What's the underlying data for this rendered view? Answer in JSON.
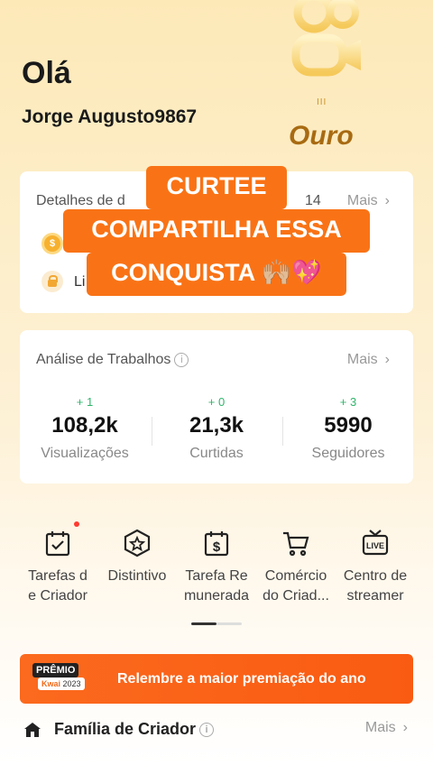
{
  "greeting": "Olá",
  "username": "Jorge Augusto9867",
  "level": {
    "tier": "Ouro",
    "roman": "III"
  },
  "earnings_card": {
    "title_start": "Detalhes de d",
    "title_suffix": "14",
    "more": "Mais",
    "row2_text_start": "Li"
  },
  "overlay": {
    "line1": "CURTEE",
    "line2": "COMPARTILHA ESSA",
    "line3": "CONQUISTA 🙌🏼💖"
  },
  "analytics": {
    "title": "Análise de Trabalhos",
    "more": "Mais",
    "stats": [
      {
        "delta": "+ 1",
        "value": "108,2k",
        "label": "Visualizações"
      },
      {
        "delta": "+ 0",
        "value": "21,3k",
        "label": "Curtidas"
      },
      {
        "delta": "+ 3",
        "value": "5990",
        "label": "Seguidores"
      }
    ]
  },
  "tools": [
    {
      "line1": "Tarefas d",
      "line2": "e Criador",
      "icon": "calendar-check-icon",
      "has_dot": true
    },
    {
      "line1": "Distintivo",
      "line2": "",
      "icon": "star-badge-icon",
      "has_dot": false
    },
    {
      "line1": "Tarefa Re",
      "line2": "munerada",
      "icon": "dollar-calendar-icon",
      "has_dot": false
    },
    {
      "line1": "Comércio",
      "line2": "do Criad...",
      "icon": "shopping-cart-icon",
      "has_dot": false
    },
    {
      "line1": "Centro de",
      "line2": "streamer",
      "icon": "live-tv-icon",
      "has_dot": false
    }
  ],
  "banner": {
    "badge_top": "PRÊMIO",
    "badge_brand": "Kwai",
    "badge_year": "2023",
    "text": "Relembre a maior premiação do ano"
  },
  "family": {
    "title": "Família de Criador",
    "more": "Mais"
  },
  "colors": {
    "accent": "#f97316",
    "positive": "#2fb56b",
    "gold": "#a86b12"
  }
}
